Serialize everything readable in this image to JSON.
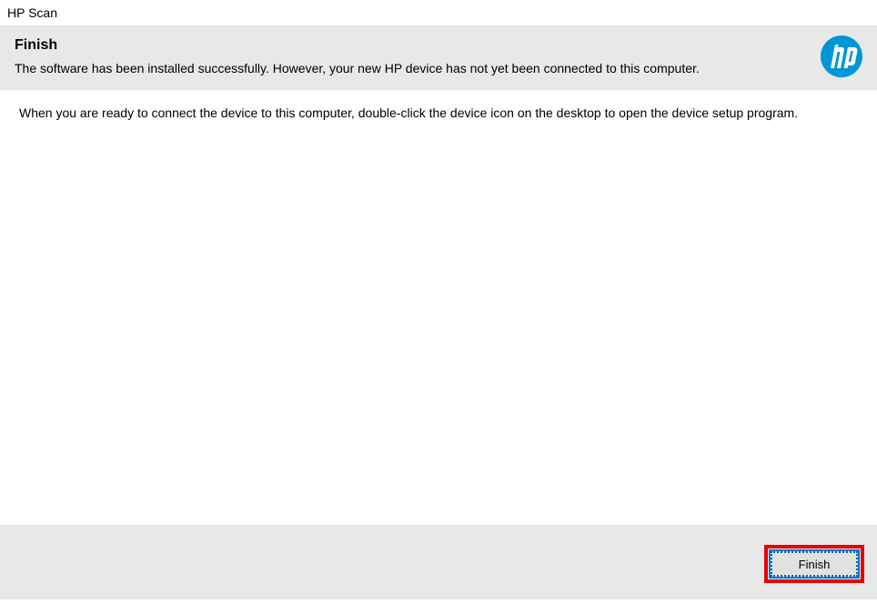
{
  "window": {
    "title": "HP Scan"
  },
  "header": {
    "title": "Finish",
    "subtitle": "The software has been installed successfully.  However, your new HP device has not yet been connected to this computer."
  },
  "content": {
    "instruction": "When you are ready to connect the device to this computer, double-click the device icon on the desktop to open the device setup program."
  },
  "footer": {
    "finish_label": "Finish"
  }
}
